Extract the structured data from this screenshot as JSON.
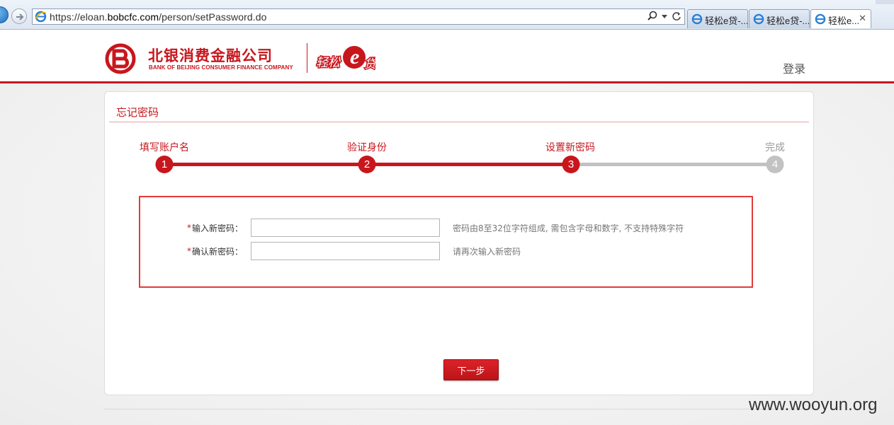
{
  "browser": {
    "url_prefix": "https://eloan.",
    "url_domain": "bobcfc.com",
    "url_path": "/person/setPassword.do",
    "tabs": [
      {
        "title": "轻松e贷-..."
      },
      {
        "title": "轻松e贷-..."
      },
      {
        "title": "轻松e..."
      }
    ],
    "close_glyph": "✕"
  },
  "header": {
    "logo_cn": "北银消费金融公司",
    "logo_en": "BANK OF BEIJING CONSUMER FINANCE COMPANY",
    "brand_text": "轻松e贷",
    "login_label": "登录",
    "accent_color": "#c8161d"
  },
  "card": {
    "title": "忘记密码"
  },
  "steps": [
    {
      "number": "1",
      "label": "填写账户名",
      "state": "done"
    },
    {
      "number": "2",
      "label": "验证身份",
      "state": "done"
    },
    {
      "number": "3",
      "label": "设置新密码",
      "state": "current"
    },
    {
      "number": "4",
      "label": "完成",
      "state": "todo"
    }
  ],
  "form": {
    "required_mark": "*",
    "new_password": {
      "label": "输入新密码：",
      "value": "",
      "hint": "密码由8至32位字符组成, 需包含字母和数字, 不支持特殊字符"
    },
    "confirm_password": {
      "label": "确认新密码：",
      "value": "",
      "hint": "请再次输入新密码"
    }
  },
  "next_button_label": "下一步",
  "watermark": "www.wooyun.org"
}
